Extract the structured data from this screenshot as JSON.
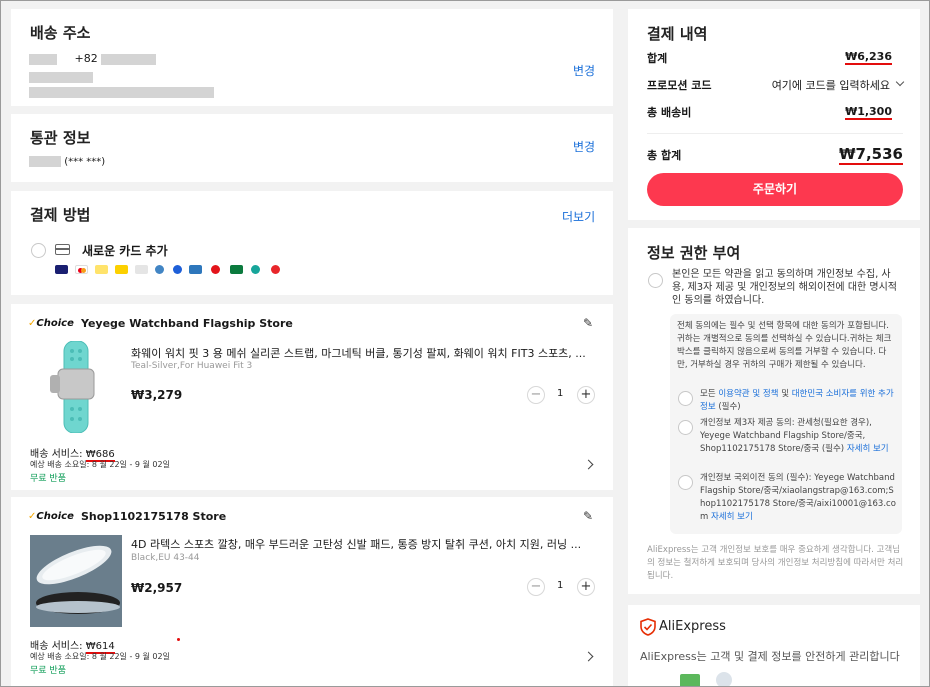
{
  "shipping": {
    "title": "배송 주소",
    "phone_prefix": "+82",
    "change_label": "변경"
  },
  "customs": {
    "title": "통관 정보",
    "masked_id": "(***            ***)",
    "change_label": "변경"
  },
  "payment_method": {
    "title": "결제 방법",
    "more_label": "더보기",
    "add_card_label": "새로운 카드 추가",
    "card_brands": [
      "VISA",
      "Mastercard",
      "Maestro",
      "KakaoPay",
      "Bank",
      "Pay",
      "Pay",
      "AmEx",
      "Pay",
      "JCB",
      "Pay",
      "Pay"
    ]
  },
  "stores": [
    {
      "badge": "Choice",
      "name": "Yeyege Watchband Flagship Store",
      "product_title": "화웨이 워치 핏 3 용 메쉬 실리콘 스트랩, 마그네틱 버클, 통기성 팔찌, 화웨이 워치 FIT3 스포츠, ...",
      "variant": "Teal-Silver,For Huawei Fit 3",
      "price": "₩3,279",
      "quantity": "1",
      "shipping_label": "배송 서비스: ",
      "shipping_fee": "₩686",
      "delivery_estimate": "예상 배송 소요일: 8 월 22일 - 9 월 02일",
      "free_return": "무료 반품"
    },
    {
      "badge": "Choice",
      "name": "Shop1102175178 Store",
      "product_title": "4D 라텍스 스포츠 깔창, 매우 부드러운 고탄성 신발 패드, 통증 방지 탈취 쿠션, 아치 지원, 러닝 ...",
      "variant": "Black,EU 43-44",
      "price": "₩2,957",
      "quantity": "1",
      "shipping_label": "배송 서비스: ",
      "shipping_fee": "₩614",
      "delivery_estimate": "예상 배송 소요일: 8 월 22일 - 9 월 02일",
      "free_return": "무료 반품"
    }
  ],
  "summary": {
    "title": "결제 내역",
    "subtotal_label": "합계",
    "subtotal": "₩6,236",
    "promo_label": "프로모션 코드",
    "promo_placeholder": "여기에 코드를 입력하세요",
    "shipping_label": "총 배송비",
    "shipping_total": "₩1,300",
    "total_label": "총 합계",
    "total": "₩7,536",
    "order_button": "주문하기"
  },
  "consent": {
    "title": "정보 권한 부여",
    "main_text": "본인은 모든 약관을 읽고 동의하며 개인정보 수집, 사용, 제3자 제공 및 개인정보의 해외이전에 대한 명시적인 동의를 하였습니다.",
    "notice": "전체 동의에는 필수 및 선택 항목에 대한 동의가 포함됩니다. 귀하는 개별적으로 동의를 선택하실 수 있습니다.귀하는 체크박스를 클릭하지 않음으로써 동의를 거부할 수 있습니다. 다만, 거부하실 경우 귀하의 구매가 제한될 수 있습니다.",
    "item1_pre": "모든 ",
    "item1_link1": "이용약관 및 정책",
    "item1_mid": " 및 ",
    "item1_link2": "대한민국 소비자를 위한 추가 정보",
    "item1_post": " (필수)",
    "item2_text": "개인정보 제3자 제공 동의: 관세청(필요한 경우), Yeyege Watchband Flagship Store/중국, Shop1102175178 Store/중국 (필수) ",
    "item2_link": "자세히 보기",
    "item3_text": "개인정보 국외이전 동의 (필수): Yeyege Watchband Flagship Store/중국/xiaolangstrap@163.com;Shop1102175178 Store/중국/aixi10001@163.com ",
    "item3_link": "자세히 보기",
    "footer": "AliExpress는 고객 개인정보 보호를 매우 중요하게 생각합니다. 고객님의 정보는 철저하게 보호되며 당사의 개인정보 처리방침에 따라서만 처리됩니다."
  },
  "security": {
    "brand": "AliExpress",
    "text": "AliExpress는 고객 및 결제 정보를 안전하게 관리합니다"
  },
  "colors": {
    "accent": "#fd384f",
    "link": "#1a6fd9",
    "underline": "#e30d0d",
    "teal_product": "#6fd6cf"
  }
}
